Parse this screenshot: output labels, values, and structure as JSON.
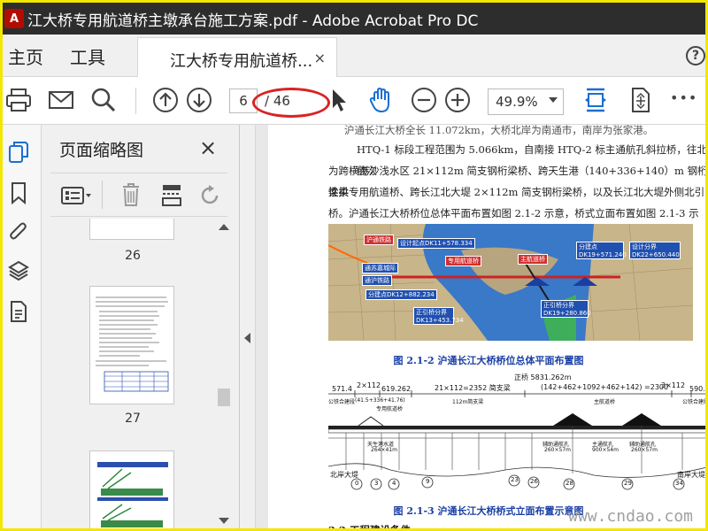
{
  "window": {
    "title": "江大桥专用航道桥主墩承台施工方案.pdf - Adobe Acrobat Pro DC",
    "app_icon": "acrobat-icon"
  },
  "menu": {
    "home": "主页",
    "tools": "工具",
    "doc_tab": "江大桥专用航道桥...",
    "tab_close": "×",
    "help": "?"
  },
  "toolbar": {
    "current_page": "6",
    "total_pages": "/ 46",
    "zoom": "49.9%",
    "more": "•••"
  },
  "thumbnails": {
    "header": "页面缩略图",
    "close": "×",
    "pages": [
      {
        "num": "26"
      },
      {
        "num": "27"
      }
    ]
  },
  "document": {
    "line1": "沪通长江大桥全长 11.072km，大桥北岸为南通市，南岸为张家港。",
    "line2": "HTQ-1 标段工程范围为 5.066km，自南接 HTQ-2 标主通航孔斜拉桥，往北依次",
    "line3": "为跨横港沙浅水区 21×112m 简支钢桁梁桥、跨天生港（140+336+140）m 钢桁梁柔",
    "line4": "性拱专用航道桥、跨长江北大堤 2×112m 简支钢桁梁桥，以及长江北大堤外侧北引",
    "line5": "桥。沪通长江大桥桥位总体平面布置如图 2.1-2 示意，桥式立面布置如图 2.1-3 示意。",
    "fig1_caption": "图 2.1-2  沪通长江大桥桥位总体平面布置图",
    "fig2_caption": "图 2.1-3  沪通长江大桥桥式立面布置示意图",
    "next_heading": "2.2 工程建设条件",
    "map_labels": {
      "l1": "沪通铁路",
      "l2": "设计起点DK11+578.334",
      "l3": "专用航道桥",
      "l4": "主航道桥",
      "l5": "分建点 DK19+571.240",
      "l6": "设计分界 DK22+650.440",
      "l7": "通苏嘉城际",
      "l8": "通沪铁路",
      "l9": "分建点DK12+882.234",
      "l10": "正引桥分界 DK13+453.734",
      "l11": "正引桥分界 DK19+280.860"
    },
    "elevation_labels": {
      "total": "正桥 5831.262m",
      "span1": "571.4",
      "span2": "2×112",
      "span3": "619.262",
      "span4": "21×112=2352 简支梁",
      "span5": "(142+462+1092+462+142) =2300",
      "span6": "3×112",
      "span7": "590.4",
      "sub1": "公铁合建段",
      "sub2": "(41.5+336+41.76)",
      "sub3": "专用航道桥",
      "sub4": "112m简支梁",
      "sub5": "主航道桥",
      "sub6": "公铁合建段",
      "north": "北岸大堤",
      "south": "南岸大堤",
      "nav1": "天生港水道",
      "nav1b": "264×41m",
      "nav2": "辅助通航孔",
      "nav2b": "260×57m",
      "nav3": "主通航孔",
      "nav3b": "900×54m",
      "nav4": "辅助通航孔",
      "nav4b": "260×57m",
      "pier0": "0",
      "pier3": "3",
      "pier4": "4",
      "pier9": "9",
      "pier23": "23",
      "pier26": "26",
      "pier28": "28",
      "pier29": "29",
      "pier34": "34"
    },
    "watermark": "www.cndao.com"
  }
}
